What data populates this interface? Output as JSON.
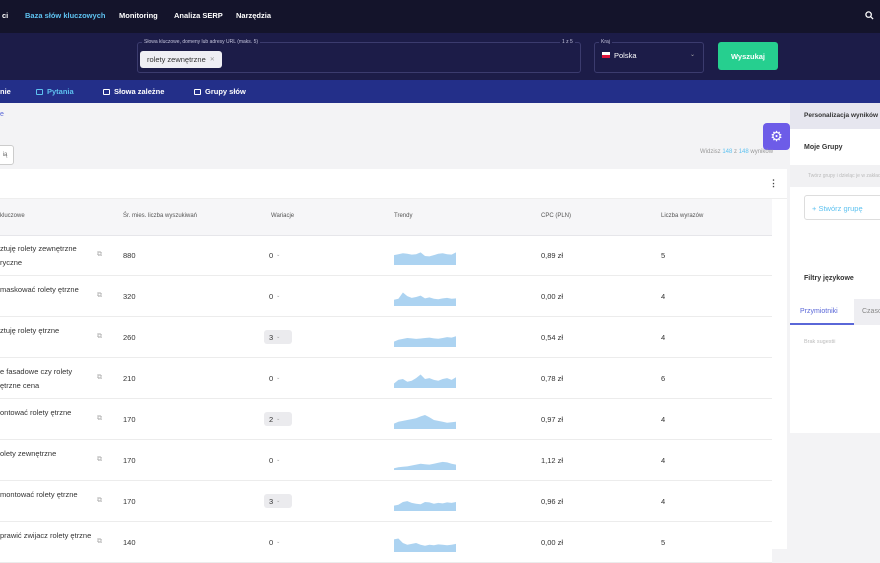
{
  "topnav": {
    "items": [
      "ci",
      "Baza słów kluczowych",
      "Monitoring",
      "Analiza SERP",
      "Narzędzia"
    ],
    "active": "Baza słów kluczowych"
  },
  "search": {
    "keyword_label": "Słowa kluczowe, domeny lub adresy URL (maks. 5)",
    "keyword_count": "1 z 5",
    "chip": "rolety zewnętrzne",
    "country_label": "Kraj",
    "country": "Polska",
    "button": "Wyszukaj"
  },
  "tabs": [
    {
      "label": "nie",
      "icon": "none"
    },
    {
      "label": "Pytania",
      "icon": "question-icon"
    },
    {
      "label": "Słowa zależne",
      "icon": "document-icon"
    },
    {
      "label": "Grupy słów",
      "icon": "groups-icon"
    }
  ],
  "main": {
    "breadcrumb": "e",
    "left_button": "ią",
    "widzisz_prefix": "Widzisz",
    "widzisz_count": "148",
    "widzisz_mid": "z",
    "widzisz_total": "148",
    "widzisz_suffix": "wyników"
  },
  "table": {
    "headers": [
      "kluczowe",
      "Śr. mies. liczba wyszukiwań",
      "Wariacje",
      "Trendy",
      "CPC (PLN)",
      "Liczba wyrazów"
    ],
    "rows": [
      {
        "keyword": "ztuję rolety zewnętrzne ryczne",
        "volume": "880",
        "variations": "0",
        "cpc": "0,89 zł",
        "words": "5",
        "var_box": false,
        "trend": [
          0.55,
          0.6,
          0.65,
          0.62,
          0.58,
          0.6,
          0.7,
          0.5,
          0.48,
          0.55,
          0.62,
          0.65,
          0.6,
          0.58,
          0.7
        ]
      },
      {
        "keyword": "maskować rolety ętrzne",
        "volume": "320",
        "variations": "0",
        "cpc": "0,00 zł",
        "words": "4",
        "var_box": false,
        "trend": [
          0.35,
          0.4,
          0.75,
          0.55,
          0.45,
          0.5,
          0.58,
          0.42,
          0.48,
          0.4,
          0.38,
          0.42,
          0.45,
          0.4,
          0.42
        ]
      },
      {
        "keyword": "ztuję rolety ętrzne",
        "volume": "260",
        "variations": "3",
        "cpc": "0,54 zł",
        "words": "4",
        "var_box": true,
        "trend": [
          0.3,
          0.4,
          0.45,
          0.5,
          0.48,
          0.45,
          0.47,
          0.5,
          0.52,
          0.48,
          0.46,
          0.5,
          0.55,
          0.52,
          0.6
        ]
      },
      {
        "keyword": "e fasadowe czy rolety ętrzne cena",
        "volume": "210",
        "variations": "0",
        "cpc": "0,78 zł",
        "words": "6",
        "var_box": false,
        "trend": [
          0.25,
          0.45,
          0.5,
          0.35,
          0.4,
          0.55,
          0.75,
          0.5,
          0.55,
          0.45,
          0.4,
          0.5,
          0.55,
          0.45,
          0.6
        ]
      },
      {
        "keyword": "ontować rolety ętrzne",
        "volume": "170",
        "variations": "2",
        "cpc": "0,97 zł",
        "words": "4",
        "var_box": true,
        "trend": [
          0.3,
          0.4,
          0.45,
          0.5,
          0.55,
          0.6,
          0.7,
          0.78,
          0.65,
          0.5,
          0.45,
          0.4,
          0.35,
          0.38,
          0.4
        ]
      },
      {
        "keyword": "olety zewnętrzne",
        "volume": "170",
        "variations": "0",
        "cpc": "1,12 zł",
        "words": "4",
        "var_box": false,
        "trend": [
          0.1,
          0.15,
          0.18,
          0.2,
          0.25,
          0.3,
          0.35,
          0.32,
          0.3,
          0.35,
          0.4,
          0.45,
          0.42,
          0.35,
          0.3
        ]
      },
      {
        "keyword": "montować rolety ętrzne",
        "volume": "170",
        "variations": "3",
        "cpc": "0,96 zł",
        "words": "4",
        "var_box": true,
        "trend": [
          0.3,
          0.35,
          0.5,
          0.55,
          0.45,
          0.4,
          0.38,
          0.5,
          0.48,
          0.4,
          0.45,
          0.42,
          0.48,
          0.45,
          0.5
        ]
      },
      {
        "keyword": "prawić zwijacz rolety ętrzne",
        "volume": "140",
        "variations": "0",
        "cpc": "0,00 zł",
        "words": "5",
        "var_box": false,
        "trend": [
          0.7,
          0.75,
          0.5,
          0.4,
          0.45,
          0.5,
          0.4,
          0.35,
          0.4,
          0.38,
          0.42,
          0.4,
          0.38,
          0.4,
          0.45
        ]
      }
    ]
  },
  "right_panel": {
    "header": "Personalizacja wyników",
    "moje_grupy": "Moje Grupy",
    "group_info": "Twórz grupy i dzieląc je w zakładce",
    "create_group": "+ Stwórz grupę",
    "filters_title": "Filtry językowe",
    "tab1": "Przymiotniki",
    "tab2": "Czasowniki",
    "empty": "Brak sugestii"
  },
  "colors": {
    "navy": "#14142b",
    "accent": "#5ec2f0",
    "button_green": "#26cf8f",
    "tabbar": "#232f89",
    "gear": "#6d5ce8",
    "trend": "#9ecbee"
  }
}
